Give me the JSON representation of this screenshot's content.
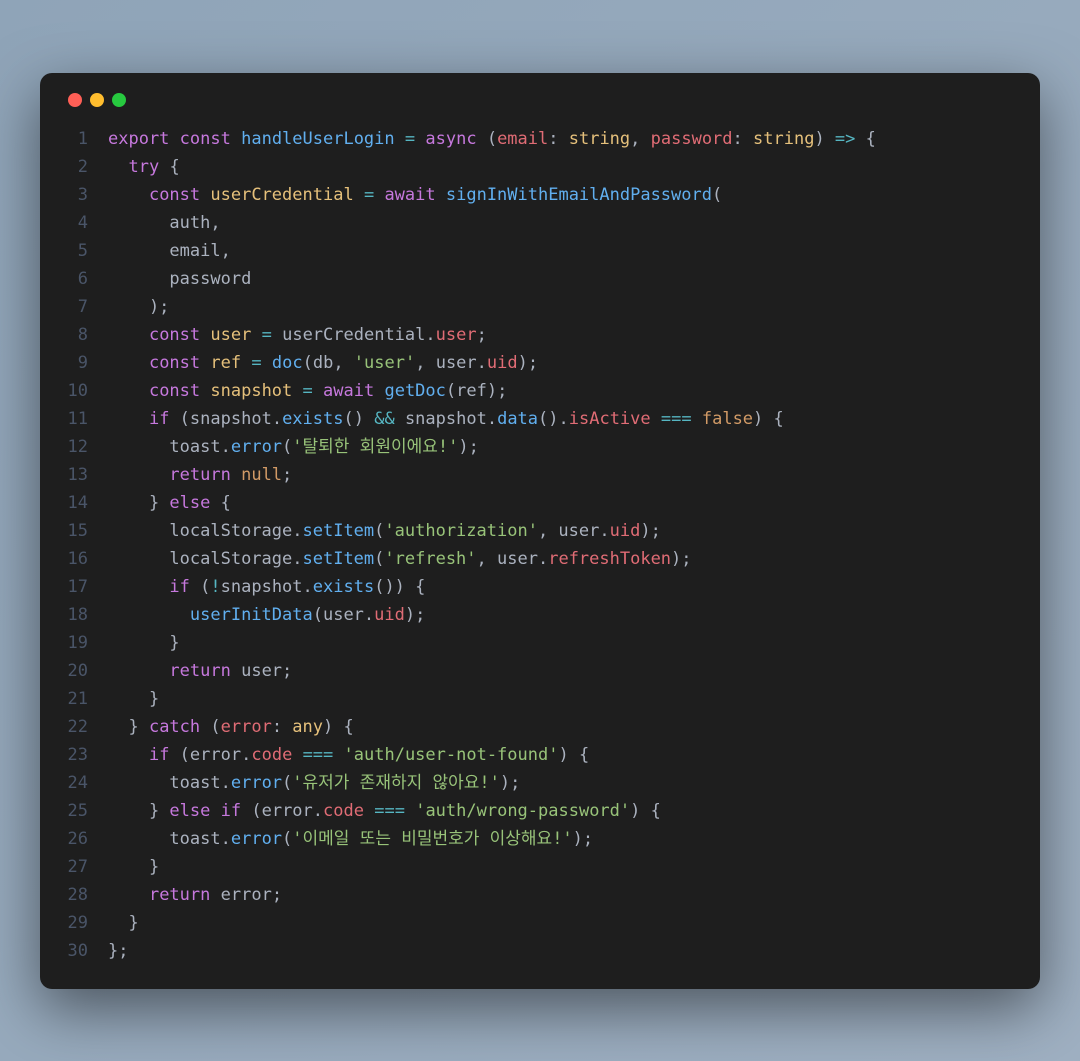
{
  "lineNumbers": [
    "1",
    "2",
    "3",
    "4",
    "5",
    "6",
    "7",
    "8",
    "9",
    "10",
    "11",
    "12",
    "13",
    "14",
    "15",
    "16",
    "17",
    "18",
    "19",
    "20",
    "21",
    "22",
    "23",
    "24",
    "25",
    "26",
    "27",
    "28",
    "29",
    "30"
  ],
  "tokens": {
    "export": "export",
    "const": "const",
    "async": "async",
    "await": "await",
    "if": "if",
    "else": "else",
    "return": "return",
    "try": "try",
    "catch": "catch",
    "null": "null",
    "false": "false",
    "handleUserLogin": "handleUserLogin",
    "email": "email",
    "password": "password",
    "string": "string",
    "userCredential": "userCredential",
    "signInWithEmailAndPassword": "signInWithEmailAndPassword",
    "auth": "auth",
    "user": "user",
    "ref": "ref",
    "doc": "doc",
    "db": "db",
    "userStr": "'user'",
    "uid": "uid",
    "snapshot": "snapshot",
    "getDoc": "getDoc",
    "exists": "exists",
    "data": "data",
    "isActive": "isActive",
    "toast": "toast",
    "error": "error",
    "msg1": "'탈퇴한 회원이에요!'",
    "localStorage": "localStorage",
    "setItem": "setItem",
    "authStr": "'authorization'",
    "refreshStr": "'refresh'",
    "refreshToken": "refreshToken",
    "userInitData": "userInitData",
    "any": "any",
    "code": "code",
    "userNotFound": "'auth/user-not-found'",
    "msg2": "'유저가 존재하지 않아요!'",
    "wrongPassword": "'auth/wrong-password'",
    "msg3": "'이메일 또는 비밀번호가 이상해요!'"
  }
}
